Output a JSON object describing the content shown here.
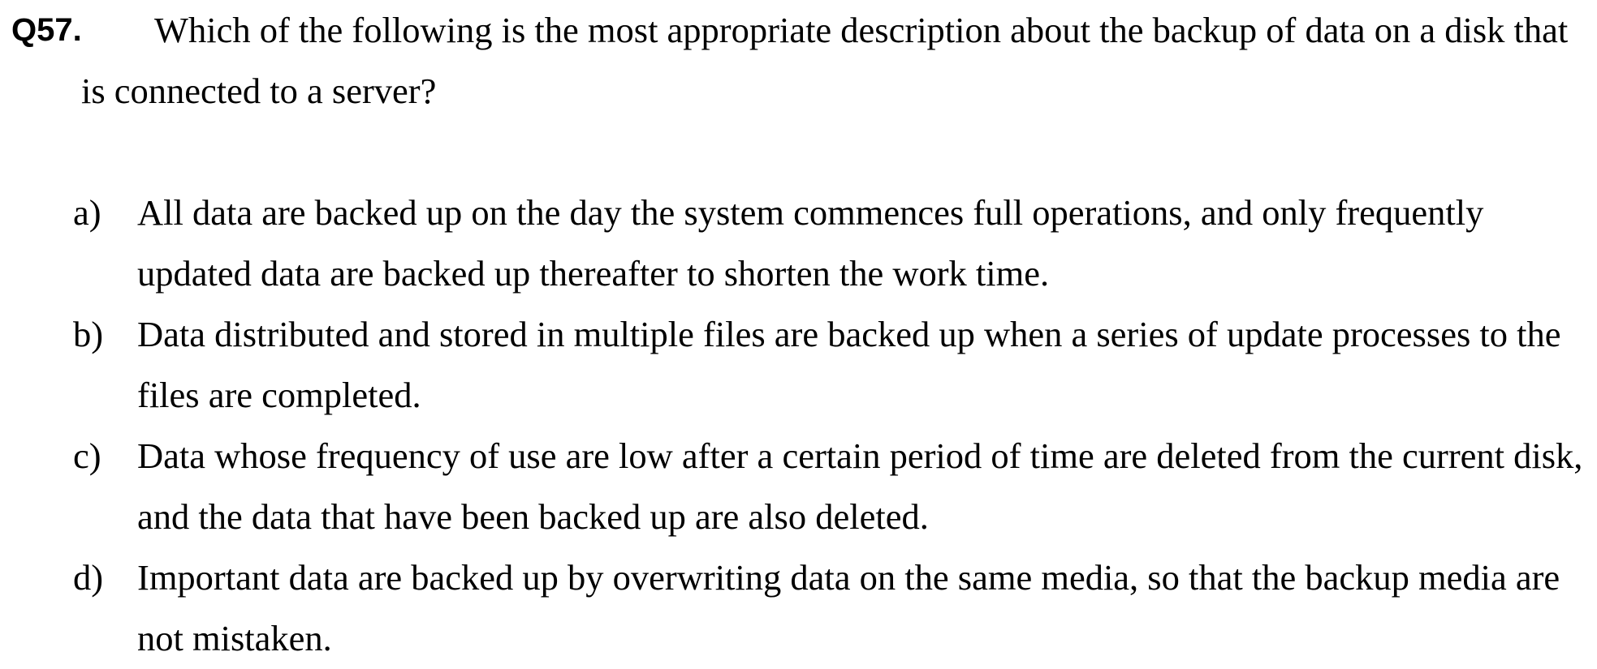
{
  "question": {
    "number": "Q57.",
    "text": "Which of the following is the most appropriate description about the backup of data on a disk that is connected to a server?"
  },
  "options": [
    {
      "label": "a)",
      "text": "All data are backed up on the day the system commences full operations, and only frequently updated data are backed up thereafter to shorten the work time."
    },
    {
      "label": "b)",
      "text": "Data distributed and stored in multiple files are backed up when a series of update processes to the files are completed."
    },
    {
      "label": "c)",
      "text": "Data whose frequency of use are low after a certain period of time are deleted from the current disk, and the data that have been backed up are also deleted."
    },
    {
      "label": "d)",
      "text": "Important data are backed up by overwriting data on the same media, so that the backup media are not mistaken."
    }
  ]
}
